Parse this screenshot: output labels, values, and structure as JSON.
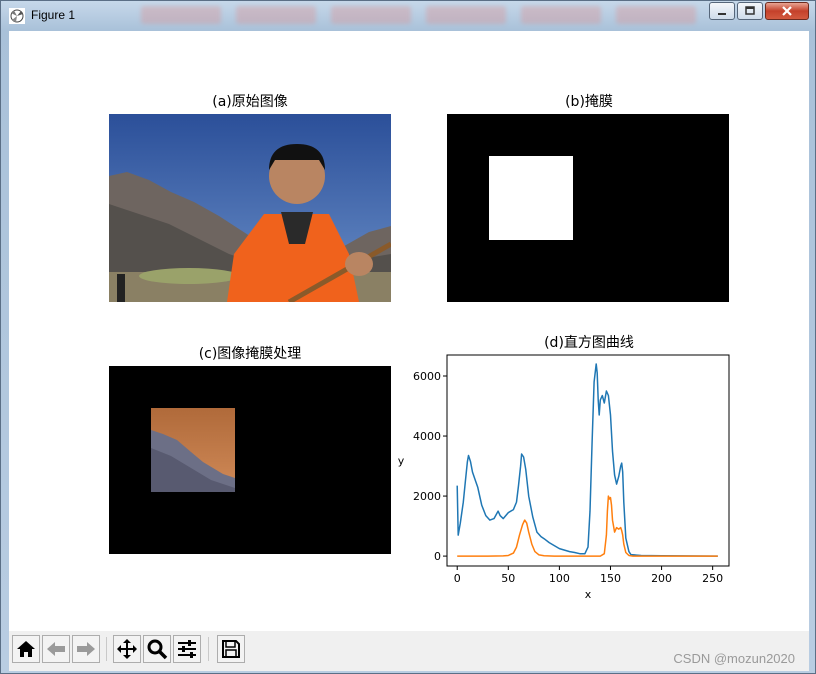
{
  "window": {
    "title": "Figure 1"
  },
  "subplots": {
    "a_title": "(a)原始图像",
    "b_title": "(b)掩膜",
    "c_title": "(c)图像掩膜处理",
    "d_title": "(d)直方图曲线"
  },
  "chart_data": {
    "type": "line",
    "title": "(d)直方图曲线",
    "xlabel": "x",
    "ylabel": "y",
    "xlim": [
      -10,
      266
    ],
    "ylim": [
      -330,
      6700
    ],
    "xticks": [
      0,
      50,
      100,
      150,
      200,
      250
    ],
    "yticks": [
      0,
      2000,
      4000,
      6000
    ],
    "series": [
      {
        "color": "#1f77b4",
        "points": [
          [
            0,
            2350
          ],
          [
            1,
            700
          ],
          [
            3,
            1100
          ],
          [
            6,
            1800
          ],
          [
            8,
            2500
          ],
          [
            10,
            3150
          ],
          [
            11,
            3350
          ],
          [
            13,
            3150
          ],
          [
            15,
            2800
          ],
          [
            18,
            2500
          ],
          [
            20,
            2300
          ],
          [
            24,
            1700
          ],
          [
            28,
            1350
          ],
          [
            32,
            1200
          ],
          [
            36,
            1250
          ],
          [
            40,
            1500
          ],
          [
            42,
            1350
          ],
          [
            45,
            1250
          ],
          [
            50,
            1450
          ],
          [
            55,
            1550
          ],
          [
            58,
            1800
          ],
          [
            60,
            2350
          ],
          [
            62,
            3000
          ],
          [
            63,
            3400
          ],
          [
            65,
            3300
          ],
          [
            67,
            2900
          ],
          [
            70,
            2000
          ],
          [
            74,
            1300
          ],
          [
            78,
            800
          ],
          [
            82,
            650
          ],
          [
            85,
            580
          ],
          [
            90,
            450
          ],
          [
            95,
            350
          ],
          [
            100,
            250
          ],
          [
            105,
            200
          ],
          [
            110,
            150
          ],
          [
            115,
            120
          ],
          [
            120,
            80
          ],
          [
            125,
            80
          ],
          [
            128,
            300
          ],
          [
            130,
            1500
          ],
          [
            132,
            3800
          ],
          [
            134,
            5800
          ],
          [
            136,
            6400
          ],
          [
            137,
            6100
          ],
          [
            138,
            5200
          ],
          [
            139,
            4700
          ],
          [
            140,
            5200
          ],
          [
            142,
            5350
          ],
          [
            144,
            5100
          ],
          [
            146,
            5500
          ],
          [
            148,
            5350
          ],
          [
            150,
            4700
          ],
          [
            152,
            3500
          ],
          [
            154,
            2700
          ],
          [
            156,
            2400
          ],
          [
            158,
            2650
          ],
          [
            160,
            3000
          ],
          [
            161,
            3100
          ],
          [
            162,
            2800
          ],
          [
            163,
            1800
          ],
          [
            165,
            600
          ],
          [
            168,
            150
          ],
          [
            170,
            50
          ],
          [
            180,
            20
          ],
          [
            200,
            10
          ],
          [
            220,
            5
          ],
          [
            255,
            0
          ]
        ]
      },
      {
        "color": "#ff7f0e",
        "points": [
          [
            0,
            0
          ],
          [
            30,
            0
          ],
          [
            45,
            5
          ],
          [
            50,
            20
          ],
          [
            55,
            100
          ],
          [
            58,
            300
          ],
          [
            61,
            700
          ],
          [
            64,
            1050
          ],
          [
            66,
            1200
          ],
          [
            68,
            1100
          ],
          [
            70,
            800
          ],
          [
            73,
            400
          ],
          [
            76,
            150
          ],
          [
            80,
            40
          ],
          [
            85,
            10
          ],
          [
            95,
            0
          ],
          [
            120,
            0
          ],
          [
            140,
            0
          ],
          [
            144,
            80
          ],
          [
            146,
            700
          ],
          [
            147,
            1500
          ],
          [
            148,
            2000
          ],
          [
            149,
            1900
          ],
          [
            150,
            1950
          ],
          [
            151,
            1700
          ],
          [
            152,
            1200
          ],
          [
            154,
            800
          ],
          [
            156,
            950
          ],
          [
            158,
            900
          ],
          [
            160,
            950
          ],
          [
            161,
            850
          ],
          [
            162,
            700
          ],
          [
            163,
            400
          ],
          [
            165,
            120
          ],
          [
            168,
            20
          ],
          [
            172,
            0
          ],
          [
            200,
            0
          ],
          [
            255,
            0
          ]
        ]
      }
    ]
  },
  "toolbar": {
    "buttons": [
      "home-icon",
      "back-icon",
      "forward-icon",
      "pan-icon",
      "zoom-icon",
      "configure-icon",
      "save-icon"
    ]
  },
  "watermark": "CSDN @mozun2020"
}
